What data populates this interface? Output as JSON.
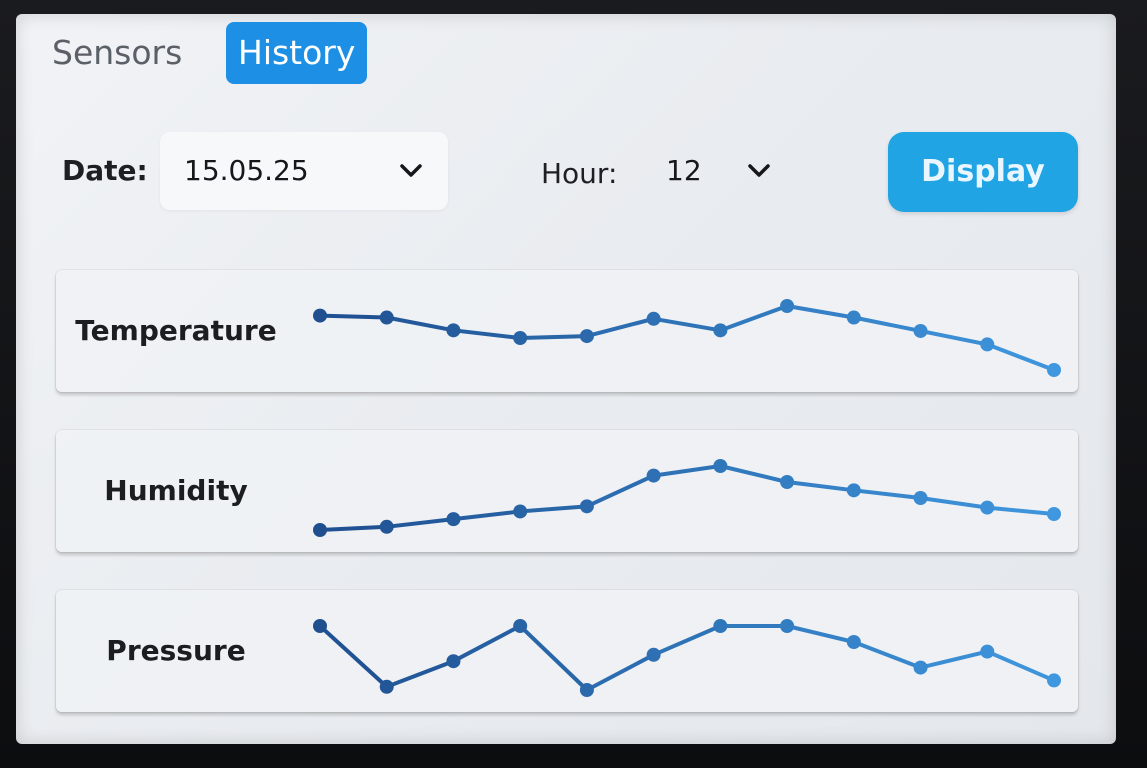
{
  "tabs": [
    {
      "label": "Sensors",
      "active": false
    },
    {
      "label": "History",
      "active": true
    }
  ],
  "filters": {
    "date_label": "Date:",
    "date_value": "15.05.25",
    "hour_label": "Hour:",
    "hour_value": "12",
    "display_label": "Display"
  },
  "colors": {
    "accent": "#1d90e6",
    "button": "#20a4e4",
    "line_dark": "#1f4f8f",
    "line_light": "#3f97df"
  },
  "chart_data": [
    {
      "type": "line",
      "name": "Temperature",
      "values": [
        0.85,
        0.82,
        0.62,
        0.5,
        0.53,
        0.8,
        0.62,
        1.0,
        0.82,
        0.61,
        0.4,
        0.0
      ]
    },
    {
      "type": "line",
      "name": "Humidity",
      "values": [
        0.0,
        0.05,
        0.17,
        0.29,
        0.37,
        0.85,
        1.0,
        0.75,
        0.62,
        0.5,
        0.35,
        0.25
      ]
    },
    {
      "type": "line",
      "name": "Pressure",
      "values": [
        1.0,
        0.05,
        0.45,
        1.0,
        0.0,
        0.55,
        1.0,
        1.0,
        0.75,
        0.35,
        0.6,
        0.15
      ]
    }
  ]
}
